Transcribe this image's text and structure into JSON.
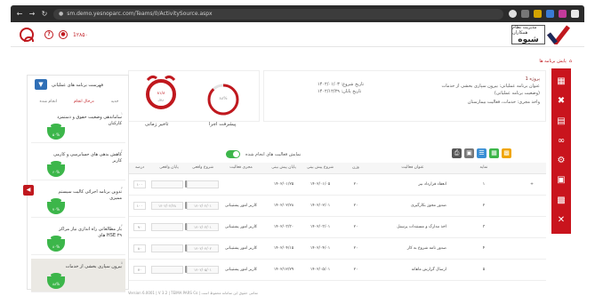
{
  "browser": {
    "url": "sm.demo.yesnoparc.com/Teams/0/ActivitySource.aspx"
  },
  "header": {
    "header_number": "1۲۸۵۰"
  },
  "logo": {
    "line1": "مدیریت نظام همکاران",
    "word": "شیوه"
  },
  "breadcrumb": {
    "label": "پایش برنامه ها"
  },
  "info": {
    "project_label": "پروژه 1",
    "program_title": "عنوان برنامه عملیاتی: بیرون سپاری بخشی از خدمات",
    "goal": "(وضعیت برنامه عملیاتی)",
    "owner": "واحد مجری: خدمات، فعالیت بیمارستان",
    "start_date": "تاریخ شروع: ۱۴۰۲/۰۱/۰۳",
    "end_date": "تاریخ پایان: ۱۴۰۲/۱۲/۲۹"
  },
  "gauges": {
    "progress_label": "پیشرفت اجرا",
    "progress_value": "۸۸%",
    "progress_fraction": 0.88,
    "delay_label": "تاخیر زمانی",
    "delay_value": "۸۱/۸",
    "delay_sub": "روز"
  },
  "toolbar": {
    "toggle_label": "نمایش فعالیت های انجام شده"
  },
  "table": {
    "headers": [
      "نمایه",
      "عنوان فعالیت",
      "وزن",
      "شروع پیش بینی",
      "پایان پیش بینی",
      "مجری فعالیت",
      "شروع واقعی",
      "پایان واقعی",
      "درصد"
    ],
    "rows": [
      {
        "idx": "۱",
        "name": "انعقاد قرارداد بیر",
        "weight": "۲۰",
        "pstart": "۱۴۰۲/۰۱/۰۵",
        "pend": "۱۴۰۲/۰۱/۲۵",
        "exec": "",
        "astart": "",
        "aend": "",
        "pct": "۱۰۰"
      },
      {
        "idx": "۲",
        "name": "صدور مجوز بکارگیری",
        "weight": "۲۰",
        "pstart": "۱۴۰۲/۰۲/۰۱",
        "pend": "۱۴۰۲/۰۲/۲۸",
        "exec": "کاربر امور پشتیبانی",
        "astart": "۱۴۰۲/۰۲/۰۱",
        "aend": "۱۴۰۲/۰۲/۲۸",
        "pct": "۱۰۰"
      },
      {
        "idx": "۳",
        "name": "اخذ مدارک و مستندات پرسنل",
        "weight": "۲۰",
        "pstart": "۱۴۰۲/۰۳/۰۱",
        "pend": "۱۴۰۲/۰۳/۳۰",
        "exec": "کاربر امور پشتیبانی",
        "astart": "۱۴۰۲/۰۳/۰۱",
        "aend": "",
        "pct": "۹۰"
      },
      {
        "idx": "۴",
        "name": "صدور نامه شروع به کار",
        "weight": "۲۰",
        "pstart": "۱۴۰۲/۰۴/۰۱",
        "pend": "۱۴۰۲/۰۴/۱۵",
        "exec": "کاربر امور پشتیبانی",
        "astart": "۱۴۰۲/۰۴/۰۲",
        "aend": "",
        "pct": "۸۰"
      },
      {
        "idx": "۵",
        "name": "ارسال گزارش ماهانه",
        "weight": "۲۰",
        "pstart": "۱۴۰۲/۰۵/۰۱",
        "pend": "۱۴۰۲/۱۲/۲۹",
        "exec": "کاربر امور پشتیبانی",
        "astart": "۱۴۰۲/۰۵/۰۱",
        "aend": "",
        "pct": "۷۰"
      }
    ]
  },
  "footer": {
    "text": "Version 6.0001 | V 3.2 | TEIMA PARS Co | تمامی حقوق این سامانه محفوظ است"
  },
  "left_panel": {
    "title": "فهرست برنامه های عملیاتی",
    "tabs": [
      "جدید",
      "درحال انجام",
      "انجام شده"
    ],
    "items": [
      {
        "num": "۱",
        "text": "ساماندهی وضعیت حقوق و دستمزد کارکنان",
        "pct": "۵۰%",
        "fill": 0.5
      },
      {
        "num": "۲",
        "text": "کاهش بدهی های حسابرسی و کارمی کاربر",
        "pct": "۶۰%",
        "fill": 0.6
      },
      {
        "num": "۳",
        "text": "تدوین برنامه اجرائی کالیت سیستم ممیزی",
        "pct": "۷۰%",
        "fill": 0.7
      },
      {
        "num": "۴",
        "text": "بار مطالعاتی راه اندازی نیاز مراکز های HSE ۲۹",
        "pct": "۸۰%",
        "fill": 0.8
      },
      {
        "num": "۵",
        "text": "بیرون سپاری بخشی از خدمات",
        "pct": "۸۸%",
        "fill": 0.88
      }
    ]
  },
  "colors": {
    "brand_red": "#c0181e",
    "accent_green": "#3cb64a",
    "filter_blue": "#2f6fb6"
  }
}
